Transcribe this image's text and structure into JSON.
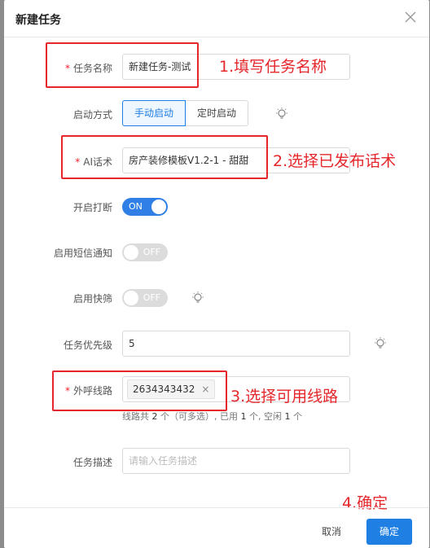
{
  "modal": {
    "title": "新建任务"
  },
  "form": {
    "task_name": {
      "label": "任务名称",
      "required_mark": "*",
      "value": "新建任务-测试"
    },
    "start_mode": {
      "label": "启动方式",
      "options": [
        "手动启动",
        "定时启动"
      ],
      "selected": "手动启动"
    },
    "ai_script": {
      "label": "AI话术",
      "required_mark": "*",
      "value": "房产装修模板V1.2-1 - 甜甜"
    },
    "interrupt": {
      "label": "开启打断",
      "state": "ON"
    },
    "sms_notify": {
      "label": "启用短信通知",
      "state": "OFF"
    },
    "quick_filter": {
      "label": "启用快筛",
      "state": "OFF"
    },
    "priority": {
      "label": "任务优先级",
      "value": "5"
    },
    "outbound_line": {
      "label": "外呼线路",
      "required_mark": "*",
      "tag": "2634343432",
      "tag_remove": "×",
      "hint": {
        "prefix": "线路共",
        "total": "2",
        "mid1": "个（可多选）, 已用",
        "used": "1",
        "mid2": "个, 空闲",
        "free": "1",
        "suffix": "个"
      }
    },
    "description": {
      "label": "任务描述",
      "placeholder": "请输入任务描述"
    }
  },
  "annotations": {
    "step1": "1.填写任务名称",
    "step2": "2.选择已发布话术",
    "step3": "3.选择可用线路",
    "step4": "4.确定",
    "color": "#e5272b"
  },
  "footer": {
    "cancel_label": "取消",
    "ok_label": "确定"
  },
  "colors": {
    "primary": "#1f7fe3",
    "required": "#f5222d"
  }
}
